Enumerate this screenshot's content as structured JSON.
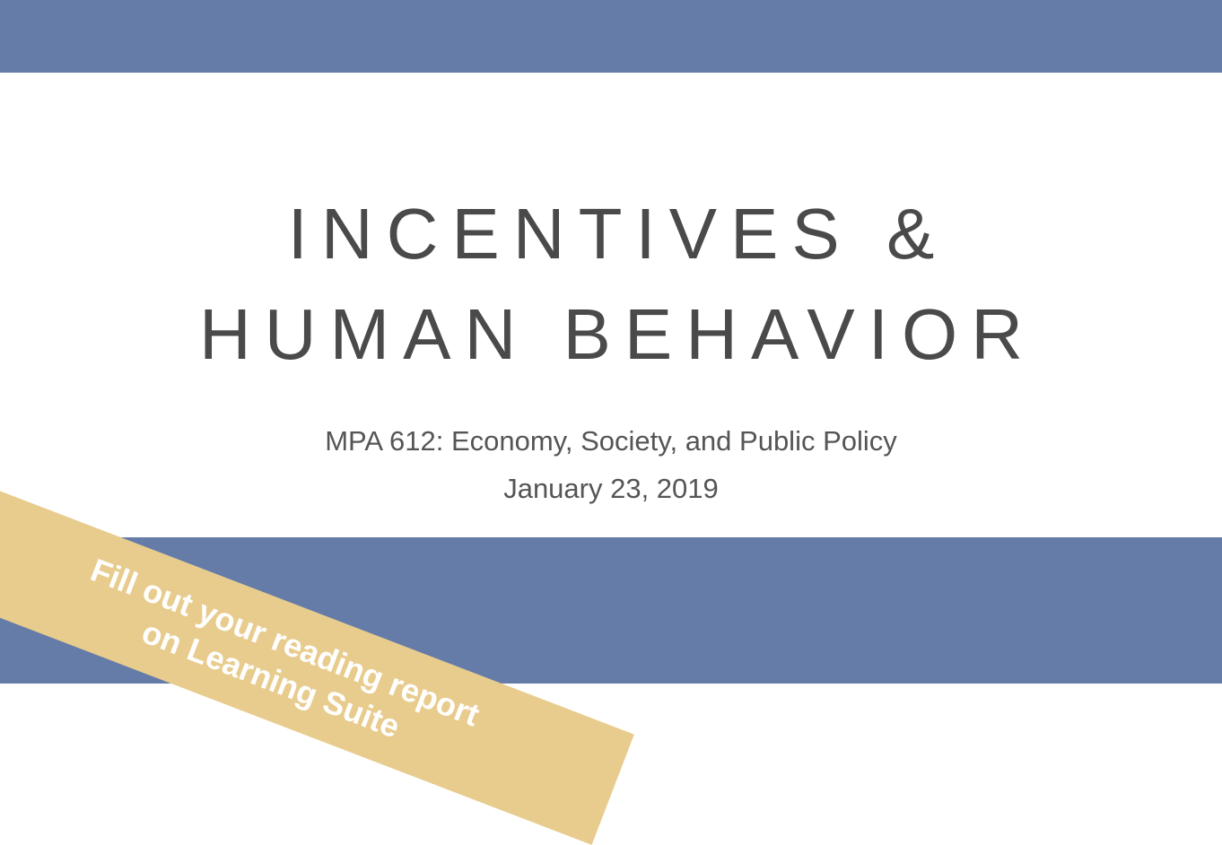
{
  "slide": {
    "title_line1": "INCENTIVES &",
    "title_line2": "HUMAN BEHAVIOR",
    "course": "MPA 612: Economy, Society, and Public Policy",
    "date": "January 23, 2019"
  },
  "ribbon": {
    "line1": "Fill out your reading report",
    "line2": "on Learning Suite"
  },
  "colors": {
    "band": "#657ca8",
    "ribbon": "#e8cc8e",
    "title_text": "#4a4a4a",
    "subtitle_text": "#555555"
  }
}
